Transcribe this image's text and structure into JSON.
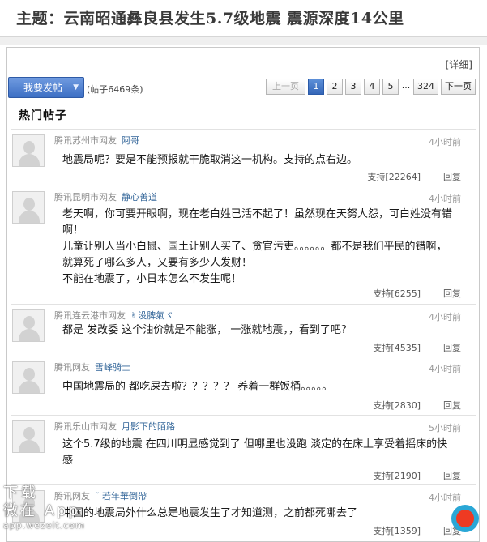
{
  "header": {
    "title": "主题：云南昭通彝良县发生5.7级地震 震源深度14公里"
  },
  "detail_link": "[详细]",
  "toolbar": {
    "post_button": "我要发帖",
    "post_count": "(帖子6469条)",
    "pager": {
      "prev": "上一页",
      "pages": [
        "1",
        "2",
        "3",
        "4",
        "5"
      ],
      "ellipsis": "...",
      "last": "324",
      "next": "下一页",
      "current": "1"
    }
  },
  "section_title": "热门帖子",
  "posts": [
    {
      "source": "腾讯苏州市网友",
      "name": "阿哥",
      "time": "4小时前",
      "lines": [
        "地震局呢？要是不能预报就干脆取消这一机构。支持的点右边。"
      ],
      "support": "支持[22264]",
      "reply": "回复"
    },
    {
      "source": "腾讯昆明市网友",
      "name": "静心善道",
      "time": "4小时前",
      "lines": [
        "老天啊，你可要开眼啊，现在老白姓已活不起了！虽然现在天努人怨，可白姓没有错啊！",
        "儿童让别人当小白鼠、国土让别人买了、贪官污吏。。。。。。都不是我们平民的错啊，就算死了哪么多人，又要有多少人发财！",
        "不能在地震了，小日本怎么不发生呢！"
      ],
      "support": "支持[6255]",
      "reply": "回复"
    },
    {
      "source": "腾讯连云港市网友",
      "name": "✌没脾氣ヾ",
      "time": "4小时前",
      "lines": [
        "都是 发改委 这个油价就是不能涨， 一涨就地震，，看到了吧?"
      ],
      "support": "支持[4535]",
      "reply": "回复"
    },
    {
      "source": "腾讯网友",
      "name": "雪峰骑士",
      "time": "4小时前",
      "lines": [
        "中国地震局的 都吃屎去啦？？？？？ 养着一群饭桶。。。。。"
      ],
      "support": "支持[2830]",
      "reply": "回复"
    },
    {
      "source": "腾讯乐山市网友",
      "name": "月影下的陌路",
      "time": "5小时前",
      "lines": [
        "这个5.7级的地震 在四川明显感觉到了 但哪里也没跑 淡定的在床上享受着摇床的快感"
      ],
      "support": "支持[2190]",
      "reply": "回复"
    },
    {
      "source": "腾讯网友",
      "name": "˜ 若年華倒帶",
      "time": "4小时前",
      "lines": [
        "中国的地震局外什么总是地震发生了才知道测，之前都死哪去了"
      ],
      "support": "支持[1359]",
      "reply": "回复"
    }
  ],
  "watermark": {
    "line1": "下载",
    "line2": "微在 App",
    "line3": "app.wezeit.com"
  },
  "colors": {
    "accent_blue": "#3d6fc4",
    "name_link": "#336699",
    "record_ring": "#2aa7d6",
    "record_dot": "#ee3a22"
  }
}
